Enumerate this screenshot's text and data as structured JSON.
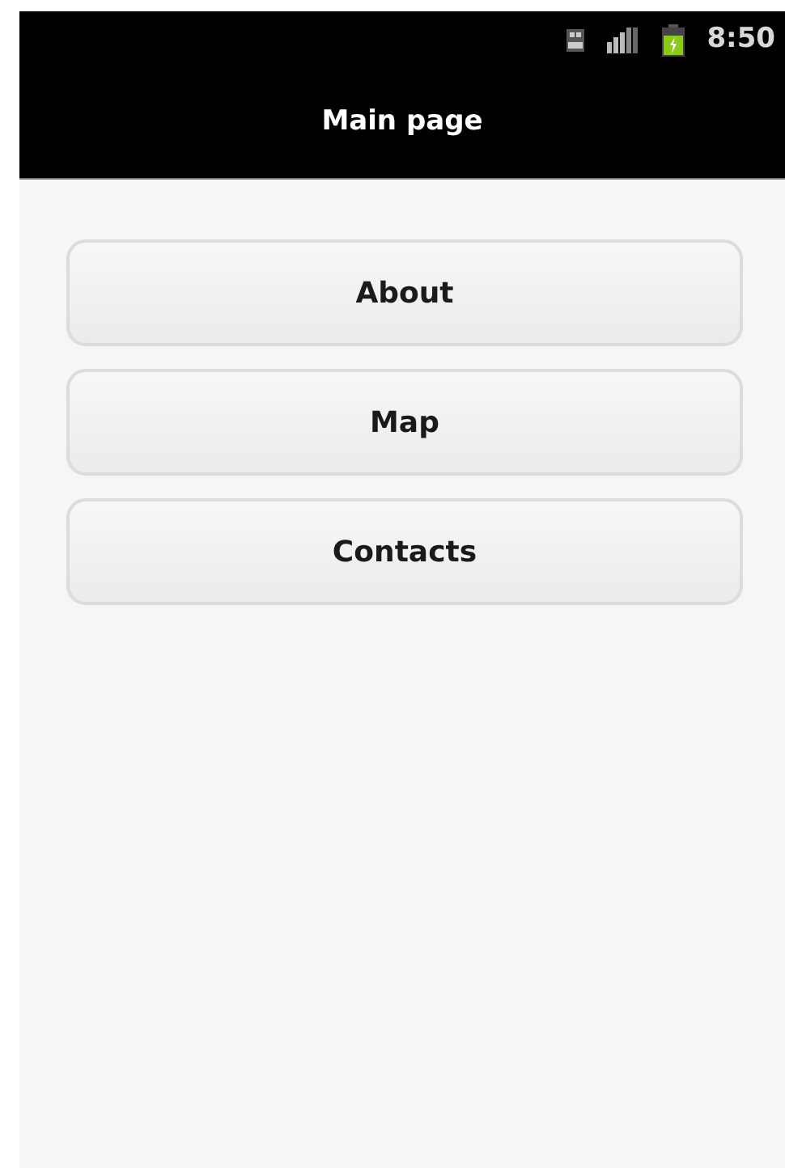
{
  "status_bar": {
    "time": "8:50"
  },
  "title": "Main page",
  "buttons": [
    {
      "label": "About"
    },
    {
      "label": "Map"
    },
    {
      "label": "Contacts"
    }
  ]
}
